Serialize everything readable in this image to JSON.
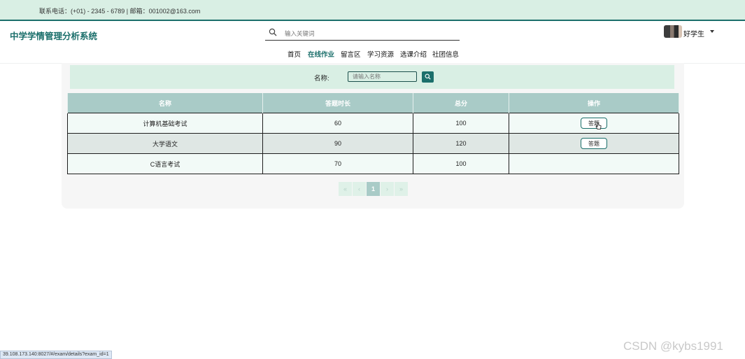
{
  "topbar": {
    "contact": "联系电话：(+01) - 2345 - 6789 | 邮箱：001002@163.com"
  },
  "header": {
    "site_title": "中学学情管理分析系统",
    "search_placeholder": "输入关键词",
    "search_icon": "search-icon",
    "user_name": "好学生"
  },
  "nav": {
    "items": [
      "首页",
      "在线作业",
      "留言区",
      "学习资源",
      "选课介绍",
      "社团信息"
    ],
    "active": "在线作业"
  },
  "filter": {
    "label": "名称:",
    "placeholder": "请输入名称",
    "button_icon": "search-icon"
  },
  "table": {
    "headers": [
      "名称",
      "答题时长",
      "总分",
      "操作"
    ],
    "rows": [
      {
        "name": "计算机基础考试",
        "duration": "60",
        "total": "100",
        "action": "答题"
      },
      {
        "name": "大学语文",
        "duration": "90",
        "total": "120",
        "action": "答题"
      },
      {
        "name": "C语言考试",
        "duration": "70",
        "total": "100",
        "action": ""
      }
    ]
  },
  "pager": {
    "first": "«",
    "prev": "‹",
    "current": "1",
    "next": "›",
    "last": "»"
  },
  "statusbar": {
    "url": "39.108.173.140:8027/#/exam/details?exam_id=1"
  },
  "watermark": "CSDN @kybs1991",
  "colors": {
    "accent": "#1b6f6b",
    "topbar_bg": "#d9efe4",
    "table_header": "#a9cbc7"
  }
}
